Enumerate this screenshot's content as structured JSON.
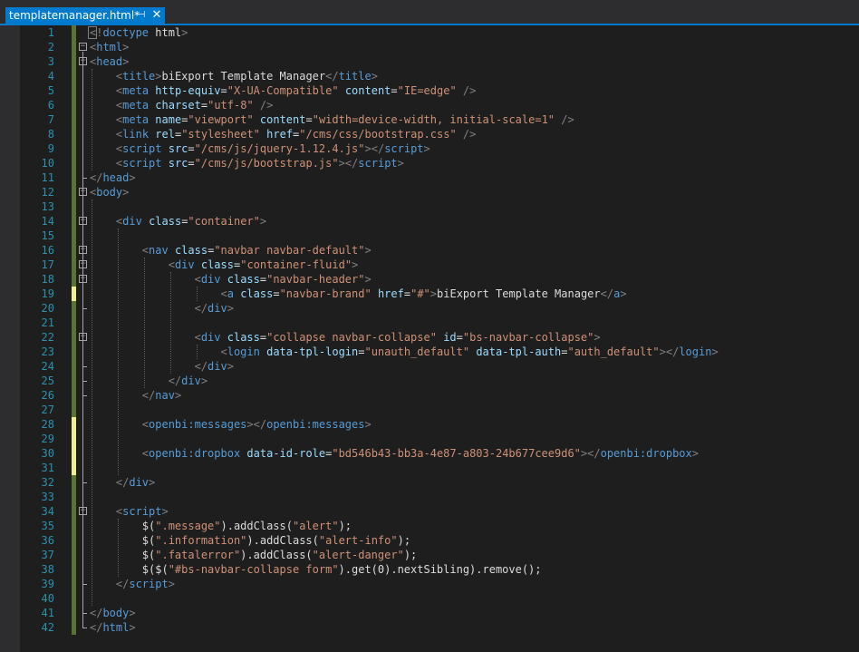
{
  "tab": {
    "title": "templatemanager.html*",
    "pin_icon": "pin-icon",
    "close_icon": "close-icon",
    "pin_glyph": "⊣",
    "close_glyph": "✕"
  },
  "colors": {
    "accent": "#007acc",
    "background": "#1e1e1e",
    "line_number": "#2b91af",
    "tag": "#569cd6",
    "attribute": "#9cdcfe",
    "string": "#ce9178",
    "text": "#dcdcdc",
    "punctuation": "#808080",
    "saved_change": "#577430",
    "unsaved_change": "#efef91"
  },
  "lines": [
    {
      "n": "1",
      "mark": "saved",
      "fold": "",
      "segs": [
        [
          "pun",
          "<!"
        ],
        [
          "dt",
          "doctype"
        ],
        [
          "txt",
          " html"
        ],
        [
          "pun",
          ">"
        ]
      ]
    },
    {
      "n": "2",
      "mark": "saved",
      "fold": "minus",
      "segs": [
        [
          "pun",
          "<"
        ],
        [
          "tag",
          "html"
        ],
        [
          "pun",
          ">"
        ]
      ]
    },
    {
      "n": "3",
      "mark": "saved",
      "fold": "minus",
      "segs": [
        [
          "pun",
          "<"
        ],
        [
          "tag",
          "head"
        ],
        [
          "pun",
          ">"
        ]
      ]
    },
    {
      "n": "4",
      "mark": "saved",
      "fold": "",
      "segs": [
        [
          "txt",
          "    "
        ],
        [
          "pun",
          "<"
        ],
        [
          "tag",
          "title"
        ],
        [
          "pun",
          ">"
        ],
        [
          "txt",
          "biExport Template Manager"
        ],
        [
          "pun",
          "</"
        ],
        [
          "tag",
          "title"
        ],
        [
          "pun",
          ">"
        ]
      ]
    },
    {
      "n": "5",
      "mark": "saved",
      "fold": "",
      "segs": [
        [
          "txt",
          "    "
        ],
        [
          "pun",
          "<"
        ],
        [
          "tag",
          "meta"
        ],
        [
          "txt",
          " "
        ],
        [
          "att",
          "http-equiv"
        ],
        [
          "txt",
          "="
        ],
        [
          "str",
          "\"X-UA-Compatible\""
        ],
        [
          "txt",
          " "
        ],
        [
          "att",
          "content"
        ],
        [
          "txt",
          "="
        ],
        [
          "str",
          "\"IE=edge\""
        ],
        [
          "txt",
          " "
        ],
        [
          "pun",
          "/>"
        ]
      ]
    },
    {
      "n": "6",
      "mark": "saved",
      "fold": "",
      "segs": [
        [
          "txt",
          "    "
        ],
        [
          "pun",
          "<"
        ],
        [
          "tag",
          "meta"
        ],
        [
          "txt",
          " "
        ],
        [
          "att",
          "charset"
        ],
        [
          "txt",
          "="
        ],
        [
          "str",
          "\"utf-8\""
        ],
        [
          "txt",
          " "
        ],
        [
          "pun",
          "/>"
        ]
      ]
    },
    {
      "n": "7",
      "mark": "saved",
      "fold": "",
      "segs": [
        [
          "txt",
          "    "
        ],
        [
          "pun",
          "<"
        ],
        [
          "tag",
          "meta"
        ],
        [
          "txt",
          " "
        ],
        [
          "att",
          "name"
        ],
        [
          "txt",
          "="
        ],
        [
          "str",
          "\"viewport\""
        ],
        [
          "txt",
          " "
        ],
        [
          "att",
          "content"
        ],
        [
          "txt",
          "="
        ],
        [
          "str",
          "\"width=device-width, initial-scale=1\""
        ],
        [
          "txt",
          " "
        ],
        [
          "pun",
          "/>"
        ]
      ]
    },
    {
      "n": "8",
      "mark": "saved",
      "fold": "",
      "segs": [
        [
          "txt",
          "    "
        ],
        [
          "pun",
          "<"
        ],
        [
          "tag",
          "link"
        ],
        [
          "txt",
          " "
        ],
        [
          "att",
          "rel"
        ],
        [
          "txt",
          "="
        ],
        [
          "str",
          "\"stylesheet\""
        ],
        [
          "txt",
          " "
        ],
        [
          "att",
          "href"
        ],
        [
          "txt",
          "="
        ],
        [
          "str",
          "\"/cms/css/bootstrap.css\""
        ],
        [
          "txt",
          " "
        ],
        [
          "pun",
          "/>"
        ]
      ]
    },
    {
      "n": "9",
      "mark": "saved",
      "fold": "",
      "segs": [
        [
          "txt",
          "    "
        ],
        [
          "pun",
          "<"
        ],
        [
          "tag",
          "script"
        ],
        [
          "txt",
          " "
        ],
        [
          "att",
          "src"
        ],
        [
          "txt",
          "="
        ],
        [
          "str",
          "\"/cms/js/jquery-1.12.4.js\""
        ],
        [
          "pun",
          "></"
        ],
        [
          "tag",
          "script"
        ],
        [
          "pun",
          ">"
        ]
      ]
    },
    {
      "n": "10",
      "mark": "saved",
      "fold": "",
      "segs": [
        [
          "txt",
          "    "
        ],
        [
          "pun",
          "<"
        ],
        [
          "tag",
          "script"
        ],
        [
          "txt",
          " "
        ],
        [
          "att",
          "src"
        ],
        [
          "txt",
          "="
        ],
        [
          "str",
          "\"/cms/js/bootstrap.js\""
        ],
        [
          "pun",
          "></"
        ],
        [
          "tag",
          "script"
        ],
        [
          "pun",
          ">"
        ]
      ]
    },
    {
      "n": "11",
      "mark": "saved",
      "fold": "",
      "segs": [
        [
          "pun",
          "</"
        ],
        [
          "tag",
          "head"
        ],
        [
          "pun",
          ">"
        ]
      ]
    },
    {
      "n": "12",
      "mark": "saved",
      "fold": "minus",
      "segs": [
        [
          "pun",
          "<"
        ],
        [
          "tag",
          "body"
        ],
        [
          "pun",
          ">"
        ]
      ]
    },
    {
      "n": "13",
      "mark": "saved",
      "fold": "",
      "segs": []
    },
    {
      "n": "14",
      "mark": "saved",
      "fold": "minus",
      "segs": [
        [
          "txt",
          "    "
        ],
        [
          "pun",
          "<"
        ],
        [
          "tag",
          "div"
        ],
        [
          "txt",
          " "
        ],
        [
          "att",
          "class"
        ],
        [
          "txt",
          "="
        ],
        [
          "str",
          "\"container\""
        ],
        [
          "pun",
          ">"
        ]
      ]
    },
    {
      "n": "15",
      "mark": "saved",
      "fold": "",
      "segs": []
    },
    {
      "n": "16",
      "mark": "saved",
      "fold": "minus",
      "segs": [
        [
          "txt",
          "        "
        ],
        [
          "pun",
          "<"
        ],
        [
          "tag",
          "nav"
        ],
        [
          "txt",
          " "
        ],
        [
          "att",
          "class"
        ],
        [
          "txt",
          "="
        ],
        [
          "str",
          "\"navbar navbar-default\""
        ],
        [
          "pun",
          ">"
        ]
      ]
    },
    {
      "n": "17",
      "mark": "saved",
      "fold": "minus",
      "segs": [
        [
          "txt",
          "            "
        ],
        [
          "pun",
          "<"
        ],
        [
          "tag",
          "div"
        ],
        [
          "txt",
          " "
        ],
        [
          "att",
          "class"
        ],
        [
          "txt",
          "="
        ],
        [
          "str",
          "\"container-fluid\""
        ],
        [
          "pun",
          ">"
        ]
      ]
    },
    {
      "n": "18",
      "mark": "saved",
      "fold": "minus",
      "segs": [
        [
          "txt",
          "                "
        ],
        [
          "pun",
          "<"
        ],
        [
          "tag",
          "div"
        ],
        [
          "txt",
          " "
        ],
        [
          "att",
          "class"
        ],
        [
          "txt",
          "="
        ],
        [
          "str",
          "\"navbar-header\""
        ],
        [
          "pun",
          ">"
        ]
      ]
    },
    {
      "n": "19",
      "mark": "unsaved",
      "fold": "",
      "segs": [
        [
          "txt",
          "                    "
        ],
        [
          "pun",
          "<"
        ],
        [
          "tag",
          "a"
        ],
        [
          "txt",
          " "
        ],
        [
          "att",
          "class"
        ],
        [
          "txt",
          "="
        ],
        [
          "str",
          "\"navbar-brand\""
        ],
        [
          "txt",
          " "
        ],
        [
          "att",
          "href"
        ],
        [
          "txt",
          "="
        ],
        [
          "str",
          "\"#\""
        ],
        [
          "pun",
          ">"
        ],
        [
          "txt",
          "biExport Template Manager"
        ],
        [
          "pun",
          "</"
        ],
        [
          "tag",
          "a"
        ],
        [
          "pun",
          ">"
        ]
      ]
    },
    {
      "n": "20",
      "mark": "saved",
      "fold": "",
      "segs": [
        [
          "txt",
          "                "
        ],
        [
          "pun",
          "</"
        ],
        [
          "tag",
          "div"
        ],
        [
          "pun",
          ">"
        ]
      ]
    },
    {
      "n": "21",
      "mark": "saved",
      "fold": "",
      "segs": []
    },
    {
      "n": "22",
      "mark": "saved",
      "fold": "minus",
      "segs": [
        [
          "txt",
          "                "
        ],
        [
          "pun",
          "<"
        ],
        [
          "tag",
          "div"
        ],
        [
          "txt",
          " "
        ],
        [
          "att",
          "class"
        ],
        [
          "txt",
          "="
        ],
        [
          "str",
          "\"collapse navbar-collapse\""
        ],
        [
          "txt",
          " "
        ],
        [
          "att",
          "id"
        ],
        [
          "txt",
          "="
        ],
        [
          "str",
          "\"bs-navbar-collapse\""
        ],
        [
          "pun",
          ">"
        ]
      ]
    },
    {
      "n": "23",
      "mark": "saved",
      "fold": "",
      "segs": [
        [
          "txt",
          "                    "
        ],
        [
          "pun",
          "<"
        ],
        [
          "tag",
          "login"
        ],
        [
          "txt",
          " "
        ],
        [
          "att",
          "data-tpl-login"
        ],
        [
          "txt",
          "="
        ],
        [
          "str",
          "\"unauth_default\""
        ],
        [
          "txt",
          " "
        ],
        [
          "att",
          "data-tpl-auth"
        ],
        [
          "txt",
          "="
        ],
        [
          "str",
          "\"auth_default\""
        ],
        [
          "pun",
          "></"
        ],
        [
          "tag",
          "login"
        ],
        [
          "pun",
          ">"
        ]
      ]
    },
    {
      "n": "24",
      "mark": "saved",
      "fold": "",
      "segs": [
        [
          "txt",
          "                "
        ],
        [
          "pun",
          "</"
        ],
        [
          "tag",
          "div"
        ],
        [
          "pun",
          ">"
        ]
      ]
    },
    {
      "n": "25",
      "mark": "saved",
      "fold": "",
      "segs": [
        [
          "txt",
          "            "
        ],
        [
          "pun",
          "</"
        ],
        [
          "tag",
          "div"
        ],
        [
          "pun",
          ">"
        ]
      ]
    },
    {
      "n": "26",
      "mark": "saved",
      "fold": "",
      "segs": [
        [
          "txt",
          "        "
        ],
        [
          "pun",
          "</"
        ],
        [
          "tag",
          "nav"
        ],
        [
          "pun",
          ">"
        ]
      ]
    },
    {
      "n": "27",
      "mark": "saved",
      "fold": "",
      "segs": []
    },
    {
      "n": "28",
      "mark": "unsaved",
      "fold": "",
      "segs": [
        [
          "txt",
          "        "
        ],
        [
          "pun",
          "<"
        ],
        [
          "tag",
          "openbi:messages"
        ],
        [
          "pun",
          "></"
        ],
        [
          "tag",
          "openbi:messages"
        ],
        [
          "pun",
          ">"
        ]
      ]
    },
    {
      "n": "29",
      "mark": "unsaved",
      "fold": "",
      "segs": []
    },
    {
      "n": "30",
      "mark": "unsaved",
      "fold": "",
      "segs": [
        [
          "txt",
          "        "
        ],
        [
          "pun",
          "<"
        ],
        [
          "tag",
          "openbi:dropbox"
        ],
        [
          "txt",
          " "
        ],
        [
          "att",
          "data-id-role"
        ],
        [
          "txt",
          "="
        ],
        [
          "str",
          "\"bd546b43-bb3a-4e87-a803-24b677cee9d6\""
        ],
        [
          "pun",
          "></"
        ],
        [
          "tag",
          "openbi:dropbox"
        ],
        [
          "pun",
          ">"
        ]
      ]
    },
    {
      "n": "31",
      "mark": "unsaved",
      "fold": "",
      "segs": []
    },
    {
      "n": "32",
      "mark": "saved",
      "fold": "",
      "segs": [
        [
          "txt",
          "    "
        ],
        [
          "pun",
          "</"
        ],
        [
          "tag",
          "div"
        ],
        [
          "pun",
          ">"
        ]
      ]
    },
    {
      "n": "33",
      "mark": "saved",
      "fold": "",
      "segs": []
    },
    {
      "n": "34",
      "mark": "saved",
      "fold": "minus",
      "segs": [
        [
          "txt",
          "    "
        ],
        [
          "pun",
          "<"
        ],
        [
          "tag",
          "script"
        ],
        [
          "pun",
          ">"
        ]
      ]
    },
    {
      "n": "35",
      "mark": "saved",
      "fold": "",
      "segs": [
        [
          "txt",
          "        $("
        ],
        [
          "str",
          "\".message\""
        ],
        [
          "txt",
          ").addClass("
        ],
        [
          "str",
          "\"alert\""
        ],
        [
          "txt",
          ");"
        ]
      ]
    },
    {
      "n": "36",
      "mark": "saved",
      "fold": "",
      "segs": [
        [
          "txt",
          "        $("
        ],
        [
          "str",
          "\".information\""
        ],
        [
          "txt",
          ").addClass("
        ],
        [
          "str",
          "\"alert-info\""
        ],
        [
          "txt",
          ");"
        ]
      ]
    },
    {
      "n": "37",
      "mark": "saved",
      "fold": "",
      "segs": [
        [
          "txt",
          "        $("
        ],
        [
          "str",
          "\".fatalerror\""
        ],
        [
          "txt",
          ").addClass("
        ],
        [
          "str",
          "\"alert-danger\""
        ],
        [
          "txt",
          ");"
        ]
      ]
    },
    {
      "n": "38",
      "mark": "saved",
      "fold": "",
      "segs": [
        [
          "txt",
          "        $($("
        ],
        [
          "str",
          "\"#bs-navbar-collapse form\""
        ],
        [
          "txt",
          ").get(0).nextSibling).remove();"
        ]
      ]
    },
    {
      "n": "39",
      "mark": "saved",
      "fold": "",
      "segs": [
        [
          "txt",
          "    "
        ],
        [
          "pun",
          "</"
        ],
        [
          "tag",
          "script"
        ],
        [
          "pun",
          ">"
        ]
      ]
    },
    {
      "n": "40",
      "mark": "saved",
      "fold": "",
      "segs": []
    },
    {
      "n": "41",
      "mark": "saved",
      "fold": "",
      "segs": [
        [
          "pun",
          "</"
        ],
        [
          "tag",
          "body"
        ],
        [
          "pun",
          ">"
        ]
      ]
    },
    {
      "n": "42",
      "mark": "saved",
      "fold": "",
      "segs": [
        [
          "pun",
          "</"
        ],
        [
          "tag",
          "html"
        ],
        [
          "pun",
          ">"
        ]
      ]
    }
  ]
}
